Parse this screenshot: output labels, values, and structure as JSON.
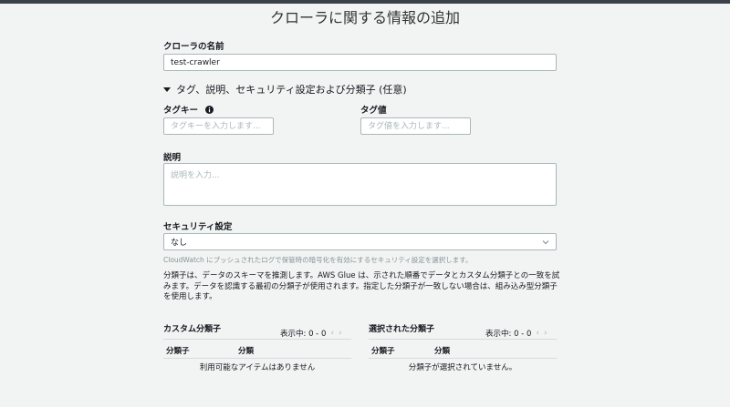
{
  "page": {
    "title": "クローラに関する情報の追加"
  },
  "crawler_name": {
    "label": "クローラの名前",
    "value": "test-crawler"
  },
  "optional_section": {
    "label": "タグ、説明、セキュリティ設定および分類子 (任意)"
  },
  "tag_key": {
    "label": "タグキー",
    "placeholder": "タグキーを入力します..."
  },
  "tag_value": {
    "label": "タグ値",
    "placeholder": "タグ値を入力します..."
  },
  "description": {
    "label": "説明",
    "placeholder": "説明を入力..."
  },
  "security": {
    "label": "セキュリティ設定",
    "selected": "なし",
    "hint": "CloudWatch にプッシュされたログで保管時の暗号化を有効にするセキュリティ設定を選択します。"
  },
  "classifier_info": "分類子は、データのスキーマを推測します。AWS Glue は、示された順番でデータとカスタム分類子との一致を試みます。データを認識する最初の分類子が使用されます。指定した分類子が一致しない場合は、組み込み型分類子を使用します。",
  "custom_classifiers": {
    "title": "カスタム分類子",
    "pager": "表示中: 0 - 0",
    "columns": [
      "分類子",
      "分類"
    ],
    "empty": "利用可能なアイテムはありません"
  },
  "selected_classifiers": {
    "title": "選択された分類子",
    "pager": "表示中: 0 - 0",
    "columns": [
      "分類子",
      "分類"
    ],
    "empty": "分類子が選択されていません。"
  },
  "icons": {
    "info": "info-icon",
    "expand": "caret-down-icon",
    "select": "chevron-down-icon",
    "prev": "chevron-left-icon",
    "next": "chevron-right-icon"
  },
  "colors": {
    "border": "#aab7b8",
    "muted": "#879596",
    "background": "#f2f3f3"
  }
}
